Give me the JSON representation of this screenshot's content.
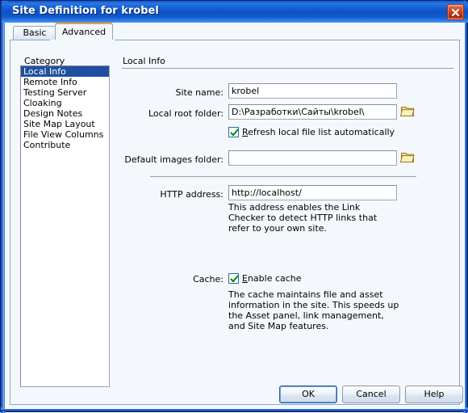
{
  "window": {
    "title": "Site Definition for krobel",
    "close_icon": "close-icon"
  },
  "tabs": [
    {
      "id": "basic",
      "label": "Basic",
      "active": false
    },
    {
      "id": "advanced",
      "label": "Advanced",
      "active": true
    }
  ],
  "category": {
    "label": "Category",
    "items": [
      {
        "label": "Local Info",
        "selected": true
      },
      {
        "label": "Remote Info",
        "selected": false
      },
      {
        "label": "Testing Server",
        "selected": false
      },
      {
        "label": "Cloaking",
        "selected": false
      },
      {
        "label": "Design Notes",
        "selected": false
      },
      {
        "label": "Site Map Layout",
        "selected": false
      },
      {
        "label": "File View Columns",
        "selected": false
      },
      {
        "label": "Contribute",
        "selected": false
      }
    ]
  },
  "panel": {
    "section_title": "Local Info",
    "site_name": {
      "label": "Site name:",
      "value": "krobel",
      "placeholder": ""
    },
    "local_root_folder": {
      "label": "Local root folder:",
      "value": "D:\\Разработки\\Сайты\\krobel\\",
      "placeholder": "",
      "browse_icon": "folder-icon"
    },
    "refresh_checkbox": {
      "label_prefix": "",
      "accel": "R",
      "label_rest": "efresh local file list automatically",
      "checked": true,
      "check_icon": "checkmark-icon"
    },
    "default_images_folder": {
      "label": "Default images folder:",
      "value": "",
      "placeholder": "",
      "browse_icon": "folder-icon"
    },
    "http_address": {
      "label": "HTTP address:",
      "value": "http://localhost/",
      "placeholder": "",
      "help": "This address enables the Link Checker to detect HTTP links that refer to your own site."
    },
    "cache": {
      "label": "Cache:",
      "accel": "E",
      "label_rest": "nable cache",
      "checked": true,
      "check_icon": "checkmark-icon",
      "help": "The cache maintains file and asset information in the site.  This speeds up the Asset panel, link management, and Site Map features."
    }
  },
  "buttons": {
    "ok": "OK",
    "cancel": "Cancel",
    "help": "Help"
  },
  "colors": {
    "titlebar_blue": "#0D51C6",
    "selection_blue": "#1F4FA0",
    "active_tab_accent": "#F0A13A",
    "close_red": "#C8391A",
    "dialog_bg": "#F4F8FD"
  }
}
